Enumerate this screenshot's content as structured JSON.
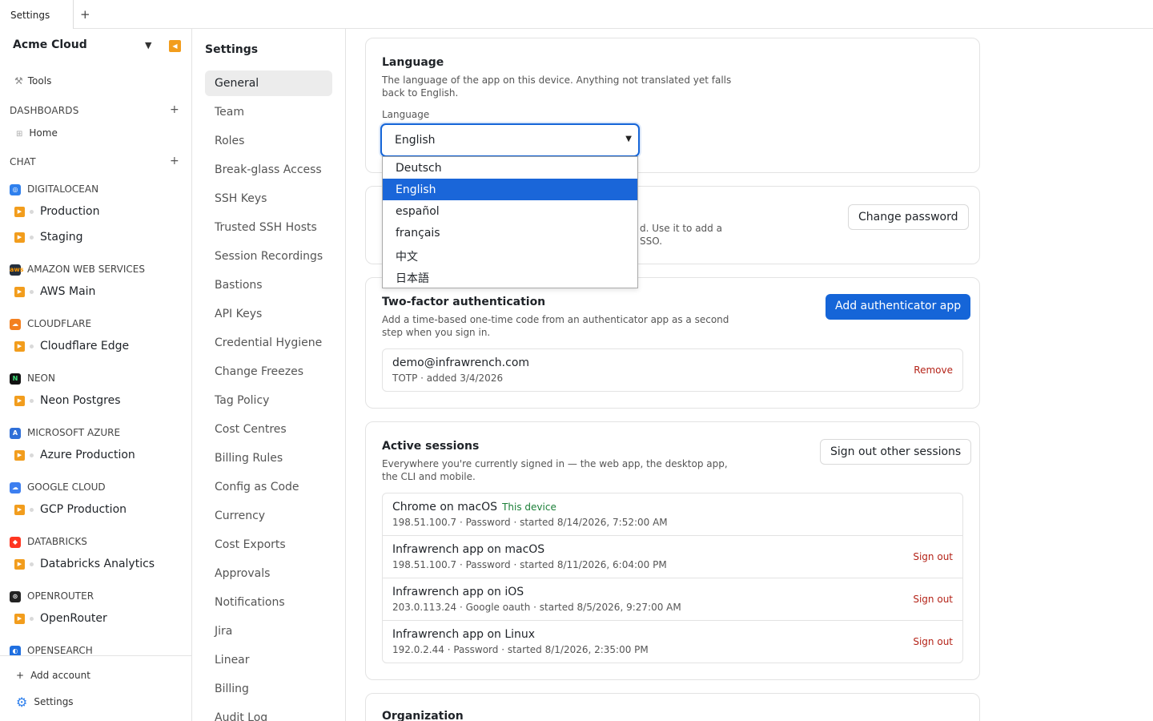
{
  "tabs": {
    "active": "Settings",
    "add": "+"
  },
  "sidebar": {
    "org_name": "Acme Cloud",
    "tools_label": "Tools",
    "dashboards_header": "DASHBOARDS",
    "home_label": "Home",
    "chat_header": "CHAT",
    "add_symbol": "+",
    "providers": [
      {
        "name": "DIGITALOCEAN",
        "icon": "digitalocean-icon",
        "color": "#2f80ed",
        "accounts": [
          "Production",
          "Staging"
        ]
      },
      {
        "name": "AMAZON WEB SERVICES",
        "icon": "aws-icon",
        "color": "#232f3e",
        "accounts": [
          "AWS Main"
        ]
      },
      {
        "name": "CLOUDFLARE",
        "icon": "cloudflare-icon",
        "color": "#f38020",
        "accounts": [
          "Cloudflare Edge"
        ]
      },
      {
        "name": "NEON",
        "icon": "neon-icon",
        "color": "#111111",
        "accounts": [
          "Neon Postgres"
        ]
      },
      {
        "name": "MICROSOFT AZURE",
        "icon": "azure-icon",
        "color": "#2f6fd8",
        "accounts": [
          "Azure Production"
        ]
      },
      {
        "name": "GOOGLE CLOUD",
        "icon": "google-cloud-icon",
        "color": "#3d7ff0",
        "accounts": [
          "GCP Production"
        ]
      },
      {
        "name": "DATABRICKS",
        "icon": "databricks-icon",
        "color": "#ff3621",
        "accounts": [
          "Databricks Analytics"
        ]
      },
      {
        "name": "OPENROUTER",
        "icon": "openrouter-icon",
        "color": "#222222",
        "accounts": [
          "OpenRouter"
        ]
      },
      {
        "name": "OPENSEARCH",
        "icon": "opensearch-icon",
        "color": "#1f6fe0",
        "accounts": []
      }
    ],
    "add_account_label": "Add account",
    "settings_label": "Settings"
  },
  "settings_nav": {
    "title": "Settings",
    "items": [
      "General",
      "Team",
      "Roles",
      "Break-glass Access",
      "SSH Keys",
      "Trusted SSH Hosts",
      "Session Recordings",
      "Bastions",
      "API Keys",
      "Credential Hygiene",
      "Change Freezes",
      "Tag Policy",
      "Cost Centres",
      "Billing Rules",
      "Config as Code",
      "Currency",
      "Cost Exports",
      "Approvals",
      "Notifications",
      "Jira",
      "Linear",
      "Billing",
      "Audit Log"
    ],
    "active": "General"
  },
  "language": {
    "title": "Language",
    "description": "The language of the app on this device. Anything not translated yet falls back to English.",
    "field_label": "Language",
    "selected": "English",
    "options": [
      "Deutsch",
      "English",
      "español",
      "français",
      "中文",
      "日本語"
    ]
  },
  "password": {
    "description_partial": "d. Use it to add a SSO.",
    "desc_line1": "d. Use it to add a",
    "desc_line2": "SSO.",
    "button": "Change password"
  },
  "two_factor": {
    "title": "Two-factor authentication",
    "description": "Add a time-based one-time code from an authenticator app as a second step when you sign in.",
    "button": "Add authenticator app",
    "entries": [
      {
        "email": "demo@infrawrench.com",
        "meta": "TOTP · added 3/4/2026",
        "action": "Remove"
      }
    ]
  },
  "sessions": {
    "title": "Active sessions",
    "description": "Everywhere you're currently signed in — the web app, the desktop app, the CLI and mobile.",
    "button": "Sign out other sessions",
    "this_device_label": "This device",
    "items": [
      {
        "name": "Chrome on macOS",
        "meta": "198.51.100.7 · Password · started 8/14/2026, 7:52:00 AM",
        "current": true,
        "action": ""
      },
      {
        "name": "Infrawrench app on macOS",
        "meta": "198.51.100.7 · Password · started 8/11/2026, 6:04:00 PM",
        "current": false,
        "action": "Sign out"
      },
      {
        "name": "Infrawrench app on iOS",
        "meta": "203.0.113.24 · Google oauth · started 8/5/2026, 9:27:00 AM",
        "current": false,
        "action": "Sign out"
      },
      {
        "name": "Infrawrench app on Linux",
        "meta": "192.0.2.44 · Password · started 8/1/2026, 2:35:00 PM",
        "current": false,
        "action": "Sign out"
      }
    ]
  },
  "organization": {
    "title": "Organization"
  }
}
